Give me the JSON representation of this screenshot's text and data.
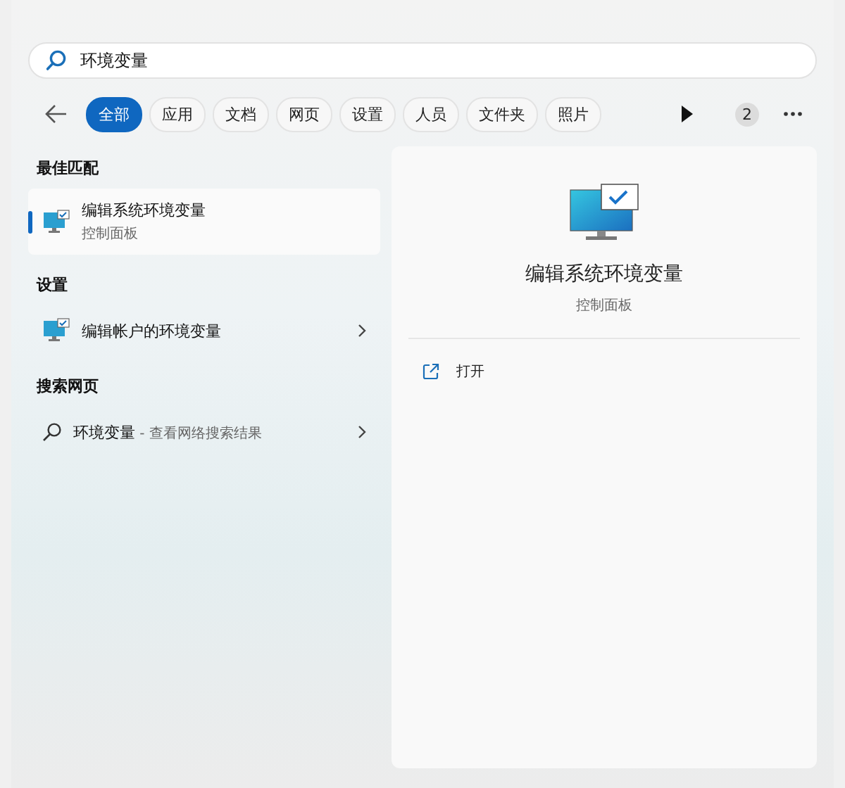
{
  "search": {
    "value": "环境变量"
  },
  "filters": [
    {
      "label": "全部",
      "selected": true
    },
    {
      "label": "应用",
      "selected": false
    },
    {
      "label": "文档",
      "selected": false
    },
    {
      "label": "网页",
      "selected": false
    },
    {
      "label": "设置",
      "selected": false
    },
    {
      "label": "人员",
      "selected": false
    },
    {
      "label": "文件夹",
      "selected": false
    },
    {
      "label": "照片",
      "selected": false
    }
  ],
  "badge": "2",
  "sections": [
    {
      "title": "最佳匹配",
      "items": [
        {
          "kind": "app",
          "title": "编辑系统环境变量",
          "subtitle": "控制面板",
          "selected": true,
          "expandable": false
        }
      ]
    },
    {
      "title": "设置",
      "items": [
        {
          "kind": "app",
          "title": "编辑帐户的环境变量",
          "selected": false,
          "expandable": true
        }
      ]
    },
    {
      "title": "搜索网页",
      "items": [
        {
          "kind": "web",
          "title": "环境变量",
          "suffix": " - 查看网络搜索结果",
          "selected": false,
          "expandable": true
        }
      ]
    }
  ],
  "preview": {
    "title": "编辑系统环境变量",
    "subtitle": "控制面板",
    "actions": [
      {
        "label": "打开"
      }
    ]
  }
}
